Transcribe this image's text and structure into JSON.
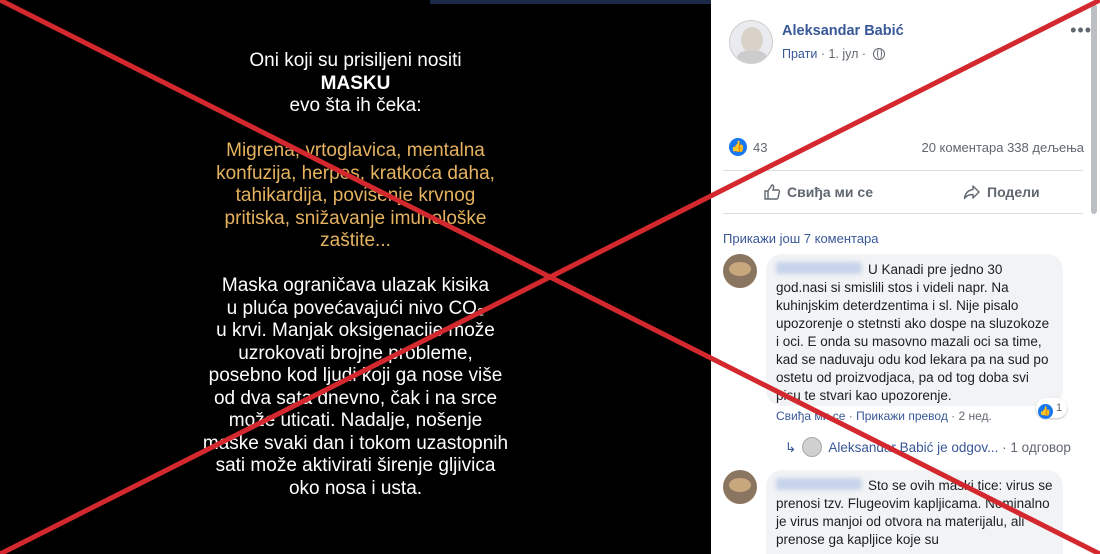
{
  "image_post": {
    "intro_line1": "Oni koji su prisiljeni nositi",
    "intro_bold": "MASKU",
    "intro_line3": "evo šta ih čeka:",
    "symptoms_lines": [
      "Migrena, vrtoglavica, mentalna",
      "konfuzija, herpes, kratkoća daha,",
      "tahikardija, povišenje krvnog",
      "pritiska, snižavanje imunološke",
      "zaštite..."
    ],
    "body_lines": [
      "Maska ograničava ulazak kisika",
      "u pluća povećavajući nivo CO₂",
      "u krvi. Manjak oksigenacije može",
      "uzrokovati brojne probleme,",
      "posebno kod ljudi koji ga nose više",
      "od dva sata dnevno, čak i na srce",
      "može uticati. Nadalje, nošenje",
      "maske svaki dan i tokom uzastopnih",
      "sati može aktivirati širenje gljivica",
      "oko nosa i usta."
    ],
    "symptom_color": "#e5b25f"
  },
  "post": {
    "author": "Aleksandar Babić",
    "follow": "Прати",
    "date": "· 1. јул ·",
    "more": "•••",
    "likes": "43",
    "comments_shares": "20 коментара  338 дељења",
    "like_action": "Свиђа ми се",
    "share_action": "Подели"
  },
  "comments": {
    "show_more": "Прикажи још 7 коментара",
    "c1": {
      "text": "U Kanadi pre jedno 30 god.nasi si smislili stos i videli napr. Na kuhinjskim deterdzentima i sl. Nije pisalo upozorenje o stetnsti ako dospe na sluzokoze i oci. E onda su masovno mazali oci sa time, kad se naduvaju odu kod lekara pa na sud po ostetu od proizvodjaca, pa od tog doba svi pisu te stvari kao upozorenje.",
      "reactions": "1",
      "like_link": "Свиђа ми се",
      "dot1": " · ",
      "translate_link": "Прикажи превод",
      "time": " · 2 нед."
    },
    "reply": {
      "arrow": "↳",
      "text": "Aleksandar Babić je odgov...",
      "count": " · 1 одговор"
    },
    "c2": {
      "text": "Sto se ovih maski tice: virus se prenosi tzv. Flugeovim kapljicama. Nominalno je virus manjoi od otvora na materijalu, ali prenose ga kapljice koje su"
    }
  },
  "colors": {
    "cross": "#d3282e",
    "link": "#385898",
    "like_blue": "#1877f2"
  }
}
